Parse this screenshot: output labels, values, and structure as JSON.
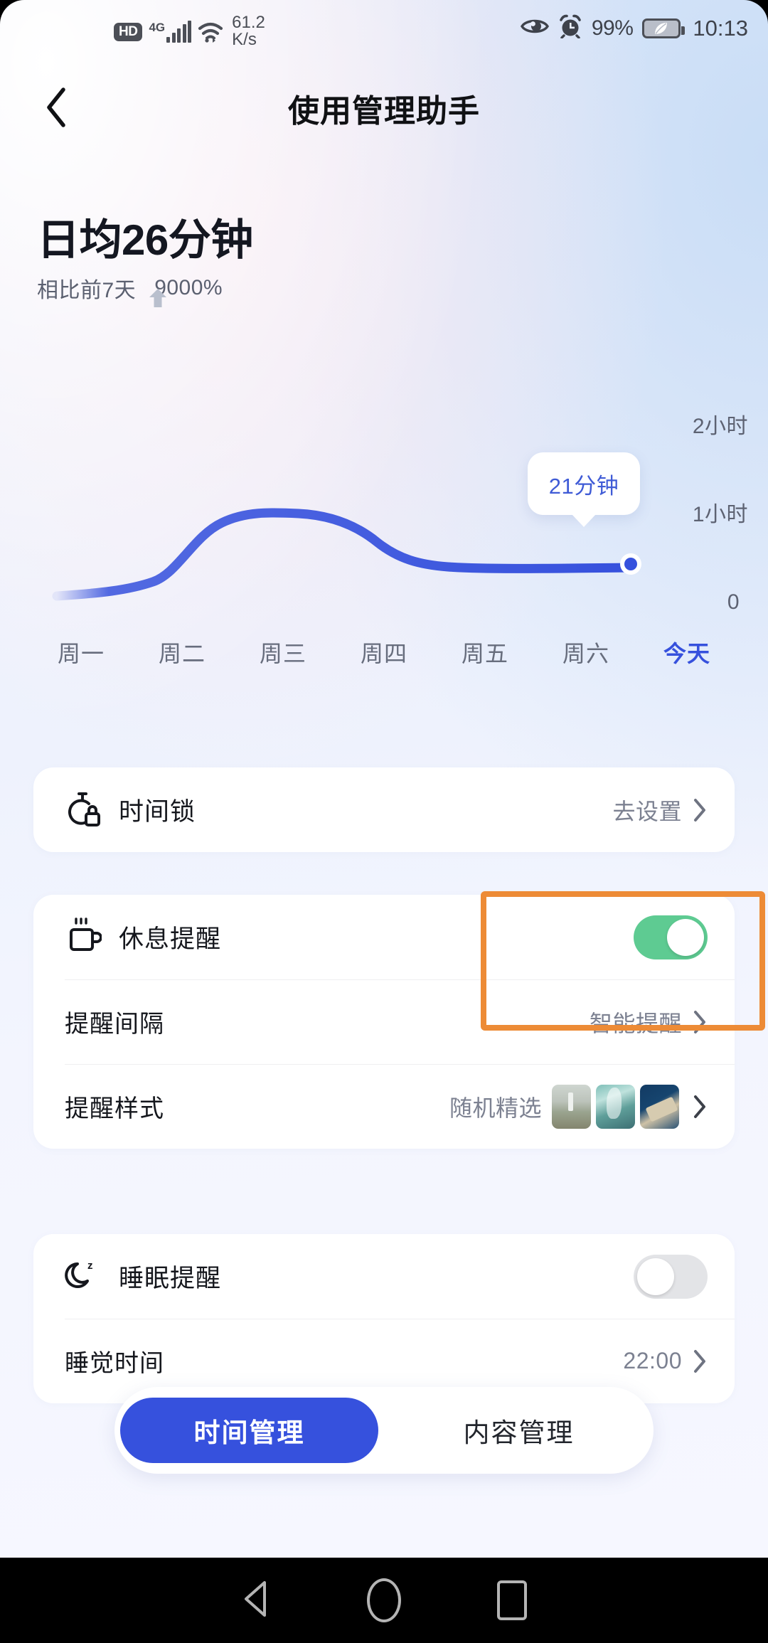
{
  "statusbar": {
    "hd": "HD",
    "network_type": "4G",
    "net_speed": "61.2",
    "net_speed_unit": "K/s",
    "battery_percent": "99%",
    "time": "10:13",
    "icons": [
      "hd-badge",
      "signal-bars-icon",
      "wifi-icon",
      "eye-comfort-icon",
      "alarm-clock-icon",
      "battery-icon"
    ]
  },
  "header": {
    "title": "使用管理助手",
    "back_icon": "chevron-left-icon"
  },
  "summary": {
    "main": "日均26分钟",
    "compare_label": "相比前7天",
    "trend_icon": "arrow-up-icon",
    "percent": "9000%"
  },
  "chart_data": {
    "type": "line",
    "title": "",
    "categories": [
      "周一",
      "周二",
      "周三",
      "周四",
      "周五",
      "周六",
      "今天"
    ],
    "values": [
      2,
      6,
      60,
      62,
      40,
      22,
      21
    ],
    "ylabel": "",
    "xlabel": "",
    "ylim": [
      0,
      120
    ],
    "yticks": [
      0,
      60,
      120
    ],
    "ytick_labels": [
      "0",
      "1小时",
      "2小时"
    ],
    "grid": false,
    "legend": false,
    "line_color": "#3651dd",
    "active_index": 6,
    "tooltip": {
      "label": "21分钟",
      "value": 21,
      "unit": "分钟"
    }
  },
  "axis_labels": {
    "y_top": "2小时",
    "y_mid": "1小时",
    "y_bottom": "0"
  },
  "cards": [
    {
      "rows": [
        {
          "name": "time-lock",
          "icon": "stopwatch-lock-icon",
          "label": "时间锁",
          "value": "去设置",
          "control": "chevron"
        }
      ]
    },
    {
      "rows": [
        {
          "name": "rest-reminder",
          "icon": "coffee-cup-icon",
          "label": "休息提醒",
          "value": "",
          "control": "toggle-on"
        },
        {
          "name": "reminder-interval",
          "icon": "",
          "label": "提醒间隔",
          "value": "智能提醒",
          "control": "chevron"
        },
        {
          "name": "reminder-style",
          "icon": "",
          "label": "提醒样式",
          "value": "随机精选",
          "control": "thumbs-chevron"
        }
      ]
    },
    {
      "rows": [
        {
          "name": "sleep-reminder",
          "icon": "moon-z-icon",
          "label": "睡眠提醒",
          "value": "",
          "control": "toggle-off"
        },
        {
          "name": "bedtime",
          "icon": "",
          "label": "睡觉时间",
          "value": "22:00",
          "control": "chevron"
        }
      ]
    }
  ],
  "tabs": [
    {
      "label": "时间管理",
      "active": true
    },
    {
      "label": "内容管理",
      "active": false
    }
  ],
  "annotation": {
    "color": "#ed8b36",
    "target": "rest-reminder-toggle"
  },
  "android_nav": {
    "back_icon": "triangle-back-icon",
    "home_icon": "circle-home-icon",
    "recents_icon": "square-recents-icon"
  },
  "colors": {
    "accent_blue": "#3651dd",
    "toggle_on_green": "#5ecb92",
    "toggle_off_grey": "#e3e4e7",
    "annotation_orange": "#ed8b36",
    "text_primary": "#15171d",
    "text_secondary": "#7c8191"
  }
}
